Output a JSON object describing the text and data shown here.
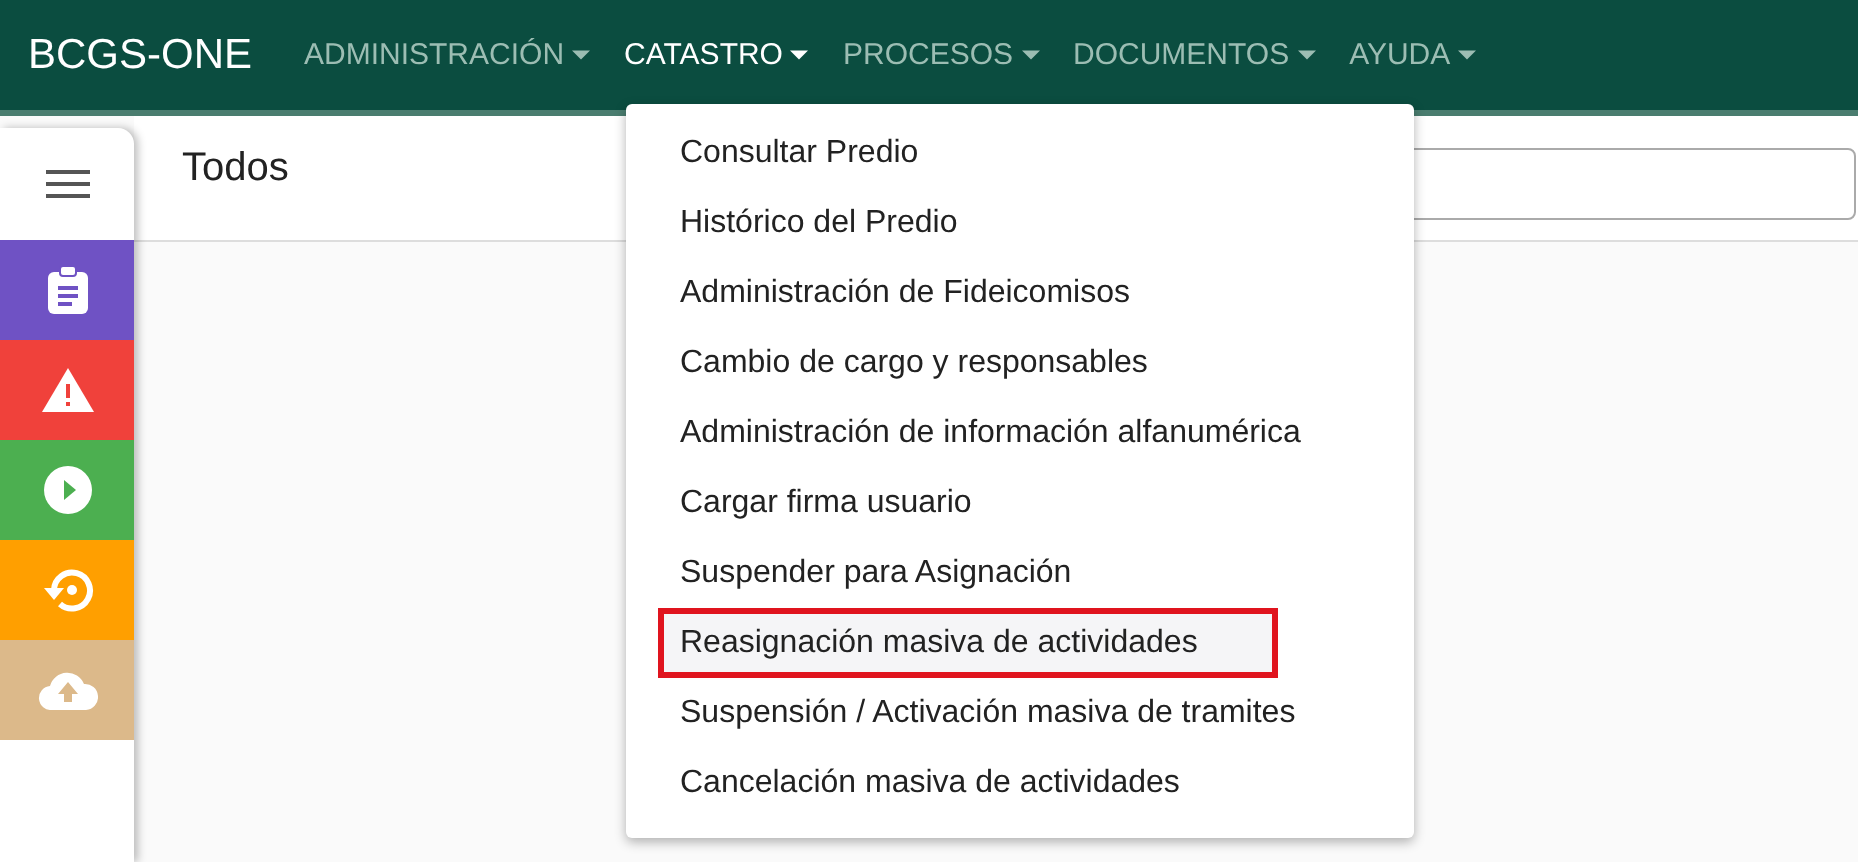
{
  "navbar": {
    "brand": "BCGS-ONE",
    "menus": [
      {
        "label": "ADMINISTRACIÓN",
        "selected": false
      },
      {
        "label": "CATASTRO",
        "selected": true
      },
      {
        "label": "PROCESOS",
        "selected": false
      },
      {
        "label": "DOCUMENTOS",
        "selected": false
      },
      {
        "label": "AYUDA",
        "selected": false
      }
    ]
  },
  "dropdown": {
    "items": [
      {
        "label": "Consultar Predio",
        "highlighted": false
      },
      {
        "label": "Histórico del Predio",
        "highlighted": false
      },
      {
        "label": "Administración de Fideicomisos",
        "highlighted": false
      },
      {
        "label": "Cambio de cargo y responsables",
        "highlighted": false
      },
      {
        "label": "Administración de información alfanumérica",
        "highlighted": false
      },
      {
        "label": "Cargar firma usuario",
        "highlighted": false
      },
      {
        "label": "Suspender para Asignación",
        "highlighted": false
      },
      {
        "label": "Reasignación masiva de actividades",
        "highlighted": true
      },
      {
        "label": "Suspensión / Activación masiva de tramites",
        "highlighted": false
      },
      {
        "label": "Cancelación masiva de actividades",
        "highlighted": false
      }
    ]
  },
  "sidebar": {
    "items": [
      {
        "kind": "clipboard",
        "color": "#6f52c4"
      },
      {
        "kind": "warning",
        "color": "#f0413b"
      },
      {
        "kind": "play",
        "color": "#4caf50"
      },
      {
        "kind": "restore",
        "color": "#ff9f00"
      },
      {
        "kind": "upload",
        "color": "#dcb98a"
      }
    ]
  },
  "page": {
    "title": "Todos"
  }
}
